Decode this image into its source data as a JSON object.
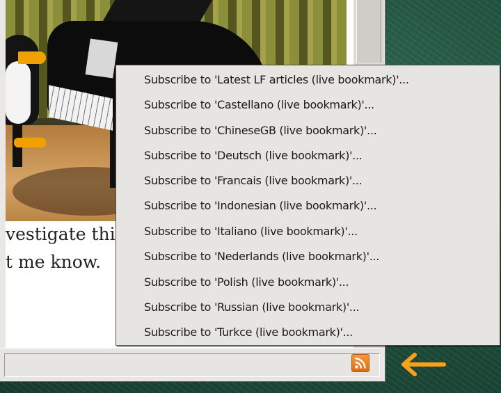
{
  "page": {
    "text_line1": "vestigate this",
    "text_line2": "t me know."
  },
  "menu": {
    "items": [
      "Subscribe to 'Latest LF articles (live bookmark)'...",
      "Subscribe to 'Castellano (live bookmark)'...",
      "Subscribe to 'ChineseGB (live bookmark)'...",
      "Subscribe to 'Deutsch (live bookmark)'...",
      "Subscribe to 'Francais (live bookmark)'...",
      "Subscribe to 'Indonesian (live bookmark)'...",
      "Subscribe to 'Italiano (live bookmark)'...",
      "Subscribe to 'Nederlands (live bookmark)'...",
      "Subscribe to 'Polish (live bookmark)'...",
      "Subscribe to 'Russian (live bookmark)'...",
      "Subscribe to 'Turkce (live bookmark)'..."
    ]
  },
  "statusbar": {
    "rss_icon": "rss-feed-icon",
    "arrow_icon": "left-arrow-icon",
    "arrow_color": "#f5a21a",
    "rss_color": "#e97a1f"
  }
}
